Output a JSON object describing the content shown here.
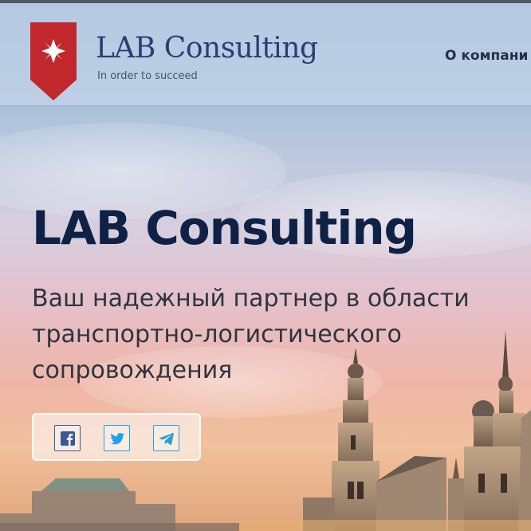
{
  "header": {
    "logo_name": "LAB Consulting",
    "logo_tagline": "In order to succeed",
    "nav": {
      "about_label": "О компани"
    }
  },
  "hero": {
    "title": "LAB Consulting",
    "subtitle": "Ваш надежный партнер в области транспортно-логистического сопровождения"
  },
  "share": {
    "buttons": [
      {
        "icon": "facebook-icon",
        "color": "#3b5998"
      },
      {
        "icon": "twitter-icon",
        "color": "#1da1f2"
      },
      {
        "icon": "telegram-icon",
        "color": "#2aa0d8"
      }
    ]
  },
  "colors": {
    "brand_red": "#c0282e",
    "brand_navy": "#2a3e74",
    "title": "#0f2144"
  }
}
